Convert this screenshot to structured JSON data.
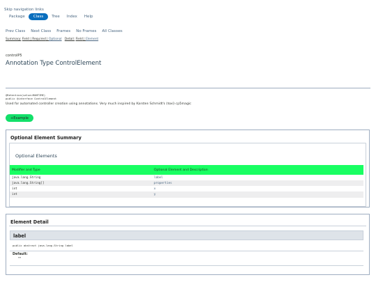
{
  "skip_link": "Skip navigation links",
  "top_nav": [
    "Package",
    "Class",
    "Tree",
    "Index",
    "Help"
  ],
  "sub_nav": [
    "Prev Class",
    "Next Class",
    "Frames",
    "No Frames",
    "All Classes"
  ],
  "summary_bar": {
    "summary_label": "Summary:",
    "field": "Field",
    "required": "Required",
    "optional": "Optional",
    "detail_label": "Detail:",
    "detail_field": "Field",
    "element": "Element"
  },
  "package": "controlP5",
  "title": "Annotation Type ControlElement",
  "annotation_lines": "@Retention(value=RUNTIME)\npublic @interface ControlElement",
  "description": "Used for automated controller creation using annotations. Very much inspired by Karsten Schmidt's (toxi) cp5magic",
  "example_button": "+Example",
  "summary_box": {
    "heading": "Optional Element Summary",
    "subheading": "Optional Elements",
    "col1": "Modifier and Type",
    "col2": "Optional Element and Description",
    "rows": [
      {
        "type": "java.lang.String",
        "name": "label"
      },
      {
        "type": "java.lang.String[]",
        "name": "properties"
      },
      {
        "type": "int",
        "name": "x"
      },
      {
        "type": "int",
        "name": "y"
      }
    ]
  },
  "detail_box": {
    "heading": "Element Detail",
    "label": "label",
    "signature": "public abstract java.lang.String label",
    "default_label": "Default:",
    "default_value": "\"\""
  },
  "colors": {
    "accent_green": "#19ff62",
    "nav_active": "#0a6ebd",
    "link": "#4a6782"
  }
}
